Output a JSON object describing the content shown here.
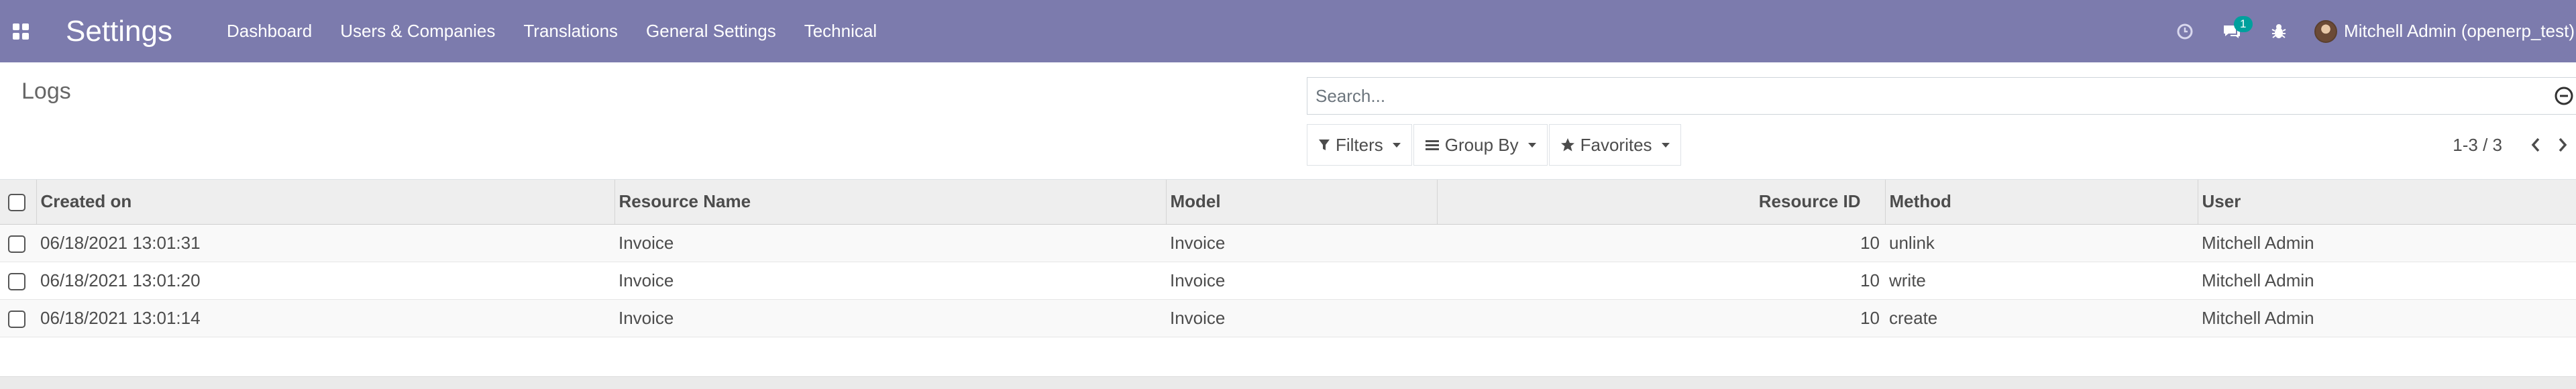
{
  "navbar": {
    "app_title": "Settings",
    "menu": [
      "Dashboard",
      "Users & Companies",
      "Translations",
      "General Settings",
      "Technical"
    ],
    "chat_badge": "1",
    "user_name": "Mitchell Admin (openerp_test)",
    "icons": [
      "apps-grid-icon",
      "clock-icon",
      "chat-icon",
      "bug-icon"
    ]
  },
  "control_panel": {
    "breadcrumb": "Logs",
    "search_placeholder": "Search...",
    "filters_label": "Filters",
    "group_by_label": "Group By",
    "favorites_label": "Favorites",
    "pager_value": "1-3 / 3"
  },
  "table": {
    "columns": [
      "Created on",
      "Resource Name",
      "Model",
      "Resource ID",
      "Method",
      "User"
    ],
    "rows": [
      [
        "06/18/2021 13:01:31",
        "Invoice",
        "Invoice",
        "10",
        "unlink",
        "Mitchell Admin"
      ],
      [
        "06/18/2021 13:01:20",
        "Invoice",
        "Invoice",
        "10",
        "write",
        "Mitchell Admin"
      ],
      [
        "06/18/2021 13:01:14",
        "Invoice",
        "Invoice",
        "10",
        "create",
        "Mitchell Admin"
      ]
    ]
  },
  "colors": {
    "navbar": "#7c7bad",
    "badge": "#00a09d",
    "header_bg": "#eeeeee"
  }
}
